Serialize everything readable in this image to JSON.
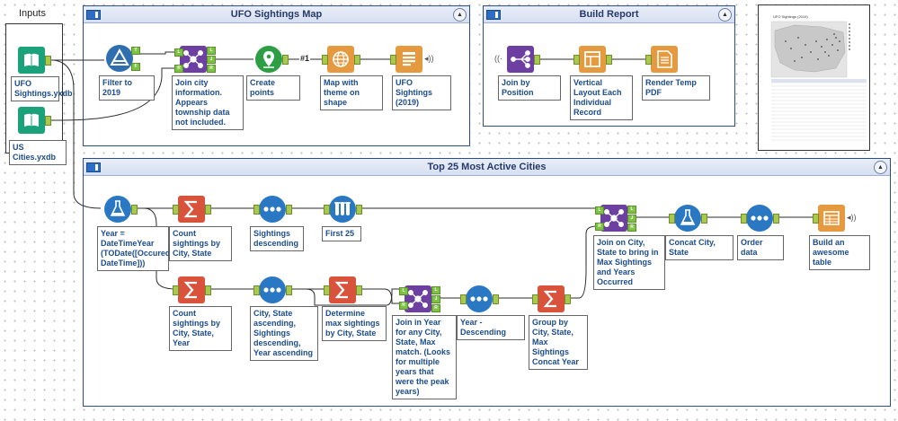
{
  "containers": {
    "inputs_title": "Inputs",
    "ufo_map": "UFO Sightings Map",
    "build_report": "Build Report",
    "top25": "Top 25 Most Active Cities"
  },
  "tools": {
    "ufo_input": "UFO Sightings.yxdb",
    "cities_input": "US Cities.yxdb",
    "filter_2019": "Filter to 2019",
    "join_city": "Join city information. Appears township data not included.",
    "create_points": "Create points",
    "layer_badge": "#1",
    "map_theme": "Map with theme on shape",
    "ufo_browse": "UFO Sightings (2019)",
    "join_position": "Join by Position",
    "vertical_layout": "Vertical Layout Each Individual Record",
    "render_pdf": "Render Temp PDF",
    "year_formula": "Year = DateTimeYear (TODate([Occured DateTime]))",
    "count_city_state": "Count sightings by City, State",
    "sightings_desc": "Sightings descending",
    "first25": "First 25",
    "join_city_state": "Join on City, State to bring in Max Sightings and Years Occurred",
    "concat_city": "Concat City, State",
    "order_data": "Order data",
    "build_table": "Build an awesome table",
    "count_city_state_year": "Count sightings by City, State, Year",
    "sort_csy": "City, State ascending, Sightings descending, Year ascending",
    "max_sightings": "Determine max sightings by City, State",
    "join_year": "Join in Year for any City, State, Max match. (Looks for multiple years that were the peak years)",
    "year_desc": "Year - Descending",
    "group_concat": "Group by City, State, Max Sightings Concat Year"
  },
  "report_preview": {
    "title": "UFO Sightings (2019)"
  },
  "colors": {
    "container_border": "#2b4d8c",
    "input_teal": "#1aa37a",
    "filter_blue": "#2f6fb0",
    "join_purple": "#6c3fa0",
    "spatial_green": "#2e9e45",
    "reporting_orange": "#e59a3f",
    "summarize_red": "#d9533c",
    "sort_blue": "#2a78c4",
    "label_text": "#1b4c8e",
    "anchor_green": "#7dc242"
  }
}
